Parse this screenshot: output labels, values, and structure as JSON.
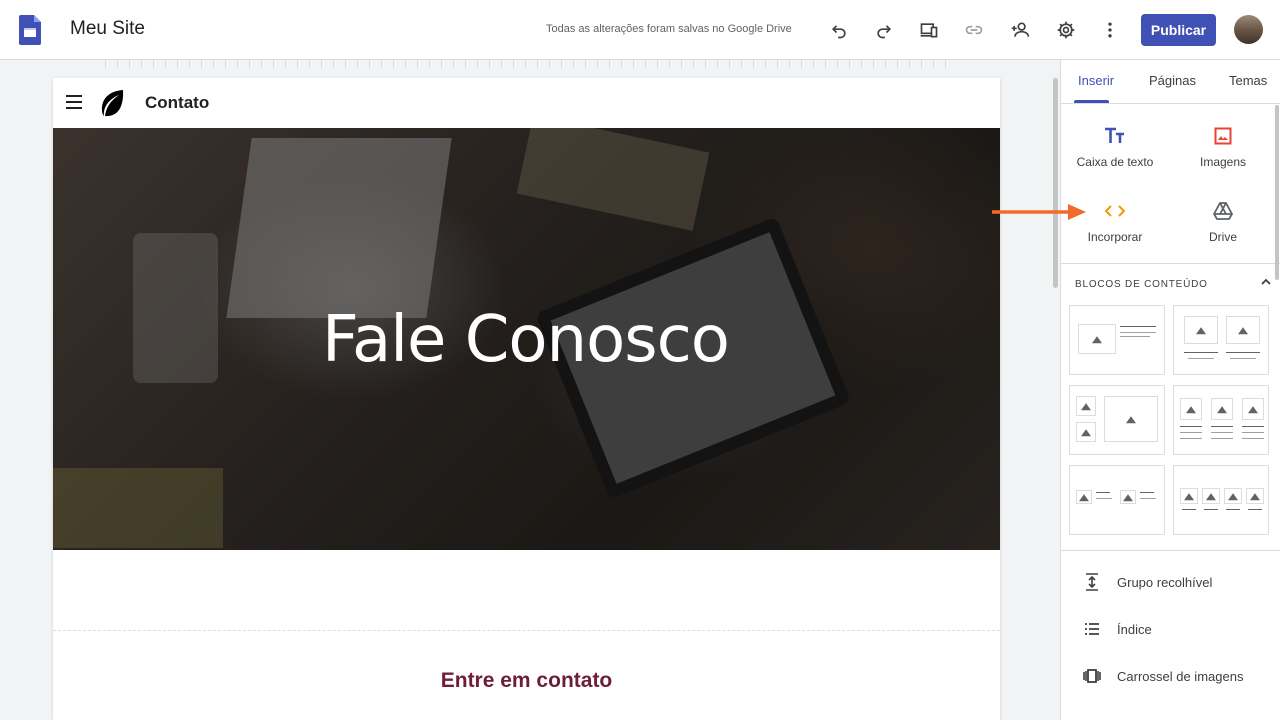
{
  "topbar": {
    "site_title": "Meu Site",
    "save_status": "Todas as alterações foram salvas no Google Drive",
    "publish_label": "Publicar"
  },
  "page": {
    "name": "Contato",
    "hero_title": "Fale Conosco",
    "contact_heading": "Entre em contato"
  },
  "panel": {
    "tabs": [
      {
        "label": "Inserir",
        "active": true
      },
      {
        "label": "Páginas",
        "active": false
      },
      {
        "label": "Temas",
        "active": false
      }
    ],
    "insert_items": [
      {
        "label": "Caixa de texto",
        "icon": "text-box-icon"
      },
      {
        "label": "Imagens",
        "icon": "image-icon"
      },
      {
        "label": "Incorporar",
        "icon": "embed-icon"
      },
      {
        "label": "Drive",
        "icon": "drive-icon"
      }
    ],
    "blocks_header": "BLOCOS DE CONTEÚDO",
    "list_items": [
      {
        "label": "Grupo recolhível",
        "icon": "collapsible-icon"
      },
      {
        "label": "Índice",
        "icon": "table-of-contents-icon"
      },
      {
        "label": "Carrossel de imagens",
        "icon": "carousel-icon"
      }
    ]
  },
  "colors": {
    "accent": "#3f51b5",
    "embed_orange": "#f29900",
    "image_red": "#ea4335",
    "heading_maroon": "#6d1f3a",
    "arrow_orange": "#ef6c2b"
  }
}
